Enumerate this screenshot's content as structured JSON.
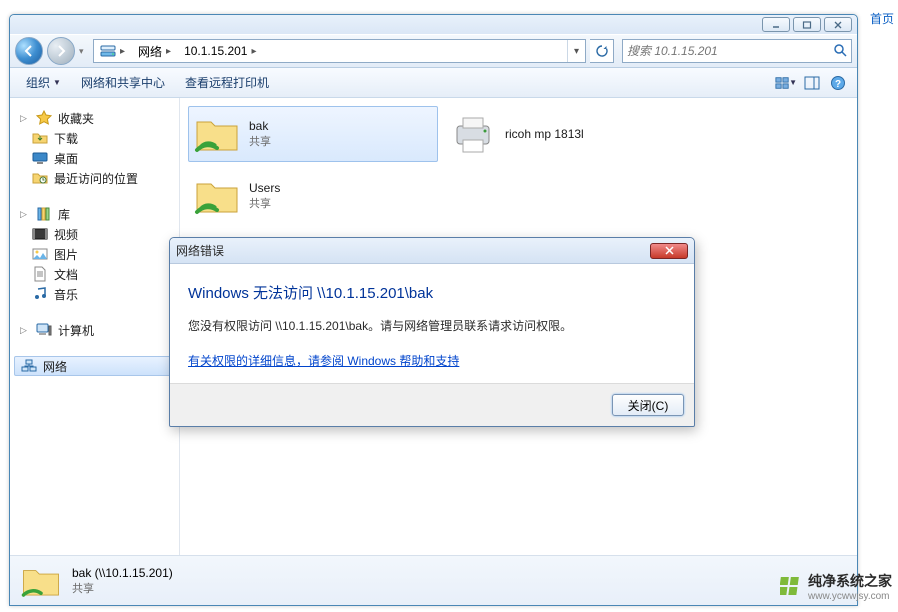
{
  "top_link": "首页",
  "address": {
    "root": "网络",
    "node": "10.1.15.201"
  },
  "search": {
    "placeholder": "搜索 10.1.15.201"
  },
  "toolbar": {
    "org": "组织",
    "net_center": "网络和共享中心",
    "view_printers": "查看远程打印机"
  },
  "sidebar": {
    "fav": {
      "title": "收藏夹",
      "downloads": "下载",
      "desktop": "桌面",
      "recent": "最近访问的位置"
    },
    "lib": {
      "title": "库",
      "videos": "视频",
      "pictures": "图片",
      "documents": "文档",
      "music": "音乐"
    },
    "computer": "计算机",
    "network": "网络"
  },
  "items": {
    "bak": {
      "name": "bak",
      "sub": "共享"
    },
    "users": {
      "name": "Users",
      "sub": "共享"
    },
    "printer": {
      "name": "ricoh mp 1813l"
    }
  },
  "details": {
    "title": "bak (\\\\10.1.15.201)",
    "sub": "共享"
  },
  "dialog": {
    "title": "网络错误",
    "heading": "Windows 无法访问 \\\\10.1.15.201\\bak",
    "message": "您没有权限访问 \\\\10.1.15.201\\bak。请与网络管理员联系请求访问权限。",
    "link": "有关权限的详细信息，请参阅 Windows 帮助和支持",
    "close_btn": "关闭(C)"
  },
  "watermark": {
    "brand": "纯净系统之家",
    "url": "www.ycwwjsy.com"
  }
}
